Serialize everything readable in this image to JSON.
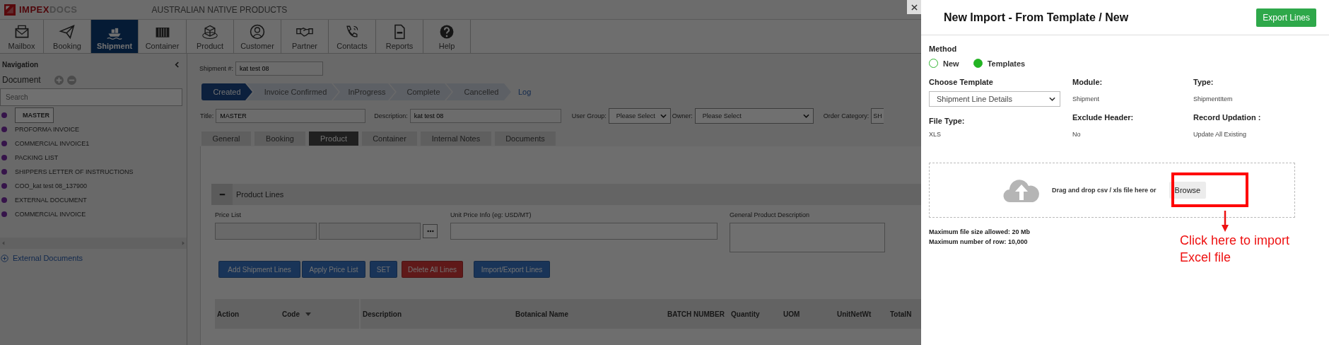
{
  "header": {
    "logo": {
      "part_1": "IMPEX",
      "part_2": "DOCS"
    },
    "company": "AUSTRALIAN NATIVE PRODUCTS"
  },
  "toolbar": [
    {
      "label": "Mailbox",
      "selected": false
    },
    {
      "label": "Booking",
      "selected": false
    },
    {
      "label": "Shipment",
      "selected": true
    },
    {
      "label": "Container",
      "selected": false
    },
    {
      "label": "Product",
      "selected": false
    },
    {
      "label": "Customer",
      "selected": false
    },
    {
      "label": "Partner",
      "selected": false
    },
    {
      "label": "Contacts",
      "selected": false
    },
    {
      "label": "Reports",
      "selected": false
    },
    {
      "label": "Help",
      "selected": false
    }
  ],
  "navigation": {
    "title": "Navigation",
    "document_label": "Document",
    "search": {
      "placeholder": "Search"
    },
    "documents": [
      {
        "label": "MASTER",
        "selected": true
      },
      {
        "label": "PROFORMA INVOICE",
        "selected": false
      },
      {
        "label": "COMMERCIAL INVOICE1",
        "selected": false
      },
      {
        "label": "PACKING LIST",
        "selected": false
      },
      {
        "label": "SHIPPERS LETTER OF INSTRUCTIONS",
        "selected": false
      },
      {
        "label": "COO_kat test 08_137900",
        "selected": false
      },
      {
        "label": "EXTERNAL DOCUMENT",
        "selected": false
      },
      {
        "label": "COMMERCIAL INVOICE",
        "selected": false
      }
    ],
    "external_documents": "External Documents"
  },
  "shipment": {
    "label": "Shipment #:",
    "value": "kat test 08"
  },
  "stages": [
    {
      "label": "Created",
      "selected": true
    },
    {
      "label": "Invoice Confirmed",
      "selected": false
    },
    {
      "label": "InProgress",
      "selected": false
    },
    {
      "label": "Complete",
      "selected": false
    },
    {
      "label": "Cancelled",
      "selected": false
    }
  ],
  "log_link": "Log",
  "fields": [
    {
      "label": "Title:",
      "value": "MASTER",
      "kind": "text"
    },
    {
      "label": "Description:",
      "value": "kat test 08",
      "kind": "text"
    },
    {
      "label": "User Group:",
      "value": "Please Select",
      "kind": "select"
    },
    {
      "label": "Owner:",
      "value": "Please Select",
      "kind": "select"
    },
    {
      "label": "Order Category:",
      "value": "SH",
      "kind": "cut"
    }
  ],
  "tabs": [
    {
      "label": "General",
      "selected": false
    },
    {
      "label": "Booking",
      "selected": false
    },
    {
      "label": "Product",
      "selected": true
    },
    {
      "label": "Container",
      "selected": false
    },
    {
      "label": "Internal Notes",
      "selected": false
    },
    {
      "label": "Documents",
      "selected": false
    }
  ],
  "product_lines": {
    "title": "Product Lines",
    "price_list_label": "Price List",
    "unit_price_label": "Unit Price Info (eg: USD/MT)",
    "description_label": "General Product Description",
    "buttons": [
      {
        "label": "Add Shipment Lines",
        "kind": "primary"
      },
      {
        "label": "Apply Price List",
        "kind": "primary"
      },
      {
        "label": "SET",
        "kind": "primary"
      },
      {
        "label": "Delete All Lines",
        "kind": "danger"
      },
      {
        "label": "Import/Export Lines",
        "kind": "primary"
      }
    ],
    "columns": [
      "Action",
      "Code",
      "Description",
      "Botanical Name",
      "BATCH NUMBER",
      "Quantity",
      "UOM",
      "UnitNetWt",
      "TotalN"
    ]
  },
  "panel": {
    "title": "New Import - From Template / New",
    "export_button": "Export Lines",
    "method_label": "Method",
    "methods": [
      {
        "label": "New",
        "selected": false
      },
      {
        "label": "Templates",
        "selected": true
      }
    ],
    "choose_template_label": "Choose Template",
    "template_value": "Shipment Line Details",
    "module_label": "Module:",
    "module_value": "Shipment",
    "type_label": "Type:",
    "type_value": "ShipmentItem",
    "file_type_label": "File Type:",
    "file_type_value": "XLS",
    "exclude_header_label": "Exclude Header:",
    "exclude_header_value": "No",
    "record_updation_label": "Record Updation :",
    "record_updation_value": "Update All Existing",
    "drop_text": "Drag and drop csv / xls file here or",
    "browse_button": "Browse",
    "limits": [
      "Maximum file size allowed: 20 Mb",
      "Maximum number of row: 10,000"
    ],
    "annotation": "Click here to import Excel file"
  }
}
